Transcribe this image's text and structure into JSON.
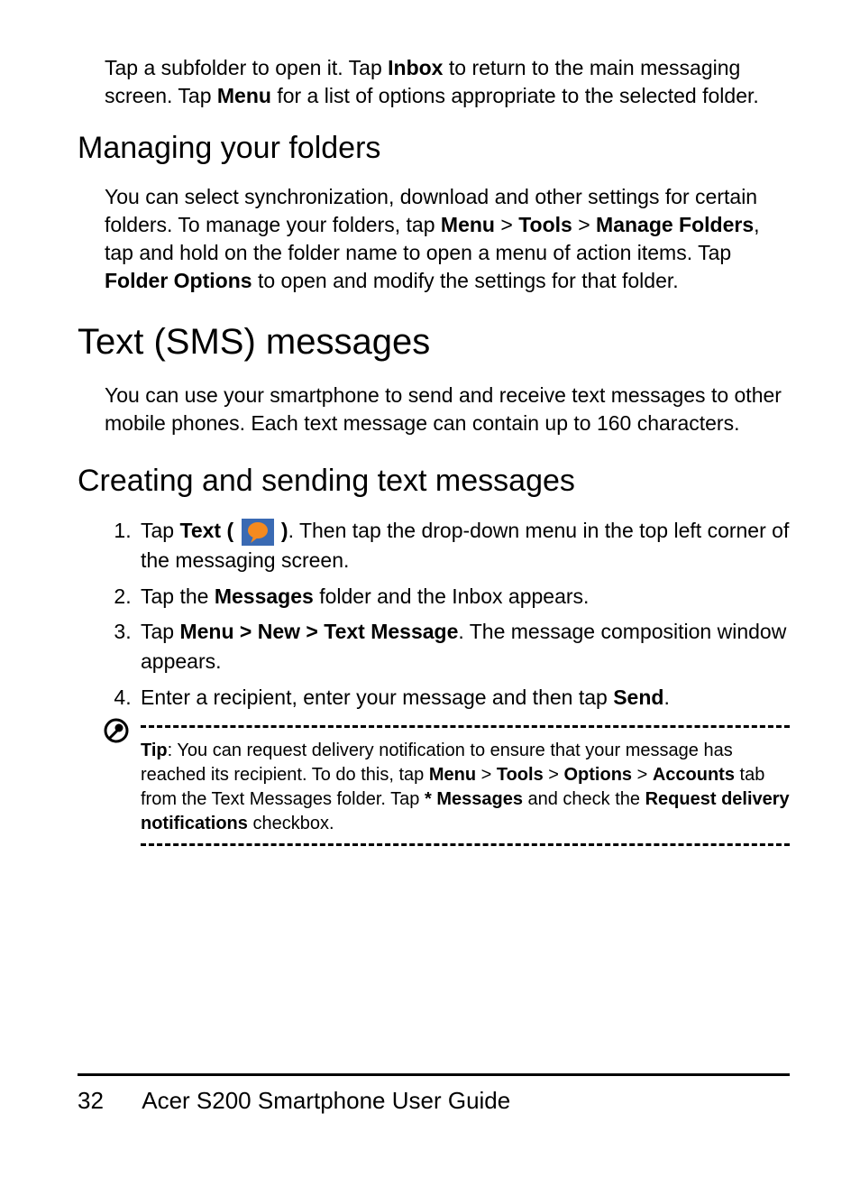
{
  "intro": {
    "p1a": "Tap a subfolder to open it. Tap ",
    "p1b_bold": "Inbox",
    "p1c": " to return to the main messaging screen. Tap ",
    "p1d_bold": "Menu",
    "p1e": " for a list of options appropriate to the selected folder."
  },
  "h2a": "Managing your folders",
  "para1": {
    "a": "You can select synchronization, download and other settings for certain folders. To manage your folders, tap ",
    "b_bold": "Menu",
    "c": " > ",
    "d_bold": "Tools",
    "e": " > ",
    "f_bold": "Manage Folders",
    "g": ", tap and hold on the folder name to open a menu of action items. Tap ",
    "h_bold": "Folder Options",
    "i": " to open and modify the settings for that folder."
  },
  "h1a": "Text (SMS) messages",
  "para2": "You can use your smartphone to send and receive text messages to other mobile phones. Each text message can contain up to 160 characters.",
  "h2b": "Creating and sending text messages",
  "steps": {
    "s1": {
      "a": "Tap ",
      "b_bold": "Text ( ",
      "c_bold": " )",
      "d": ". Then tap the drop-down menu in the top left corner of the messaging screen."
    },
    "s2": {
      "a": "Tap the ",
      "b_bold": "Messages",
      "c": " folder and the Inbox appears."
    },
    "s3": {
      "a": "Tap ",
      "b_bold": "Menu > New > Text Message",
      "c": ". The message composition window appears."
    },
    "s4": {
      "a": "Enter a recipient, enter your message and then tap ",
      "b_bold": "Send",
      "c": "."
    }
  },
  "tip": {
    "label_bold": "Tip",
    "a": ": You can request delivery notification to ensure that your message has reached its recipient. To do this, tap ",
    "b_bold": "Menu",
    "c": " > ",
    "d_bold": "Tools",
    "e": " > ",
    "f_bold": "Options",
    "g": " > ",
    "h_bold": "Accounts",
    "i": " tab from the Text Messages folder. Tap ",
    "j_bold": "* Messages",
    "k": " and check the ",
    "l_bold": "Request delivery notifications",
    "m": " checkbox."
  },
  "footer": {
    "page_number": "32",
    "title": "Acer S200 Smartphone User Guide"
  }
}
